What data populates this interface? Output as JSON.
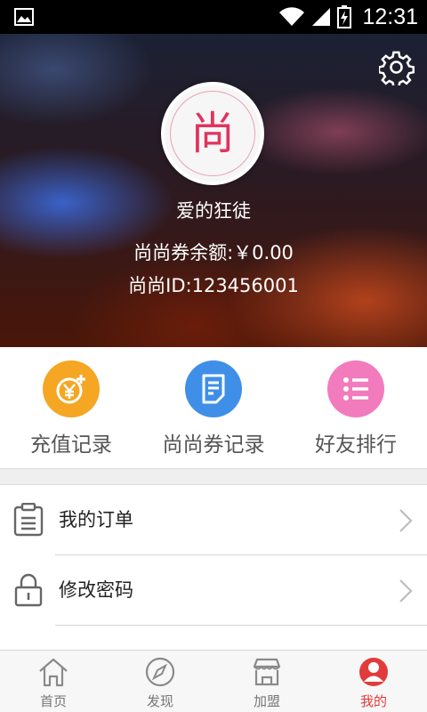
{
  "status_bar": {
    "time": "12:31"
  },
  "profile": {
    "avatar_glyph": "尚",
    "nickname": "爱的狂徒",
    "balance_text": "尚尚券余额:￥0.00",
    "id_text": "尚尚ID:123456001"
  },
  "quick_actions": [
    {
      "label": "充值记录",
      "icon": "yen-coin-plus-icon",
      "color": "#f5a623"
    },
    {
      "label": "尚尚券记录",
      "icon": "document-list-icon",
      "color": "#3f8fe8"
    },
    {
      "label": "好友排行",
      "icon": "ranking-list-icon",
      "color": "#f27bbd"
    }
  ],
  "menu": [
    {
      "label": "我的订单",
      "icon": "clipboard-icon"
    },
    {
      "label": "修改密码",
      "icon": "lock-icon"
    }
  ],
  "tabs": [
    {
      "label": "首页",
      "icon": "home-icon"
    },
    {
      "label": "发现",
      "icon": "compass-icon"
    },
    {
      "label": "加盟",
      "icon": "store-icon"
    },
    {
      "label": "我的",
      "icon": "user-icon",
      "active": true
    }
  ],
  "colors": {
    "accent": "#e23b3b",
    "brand_pink": "#e0345f"
  }
}
